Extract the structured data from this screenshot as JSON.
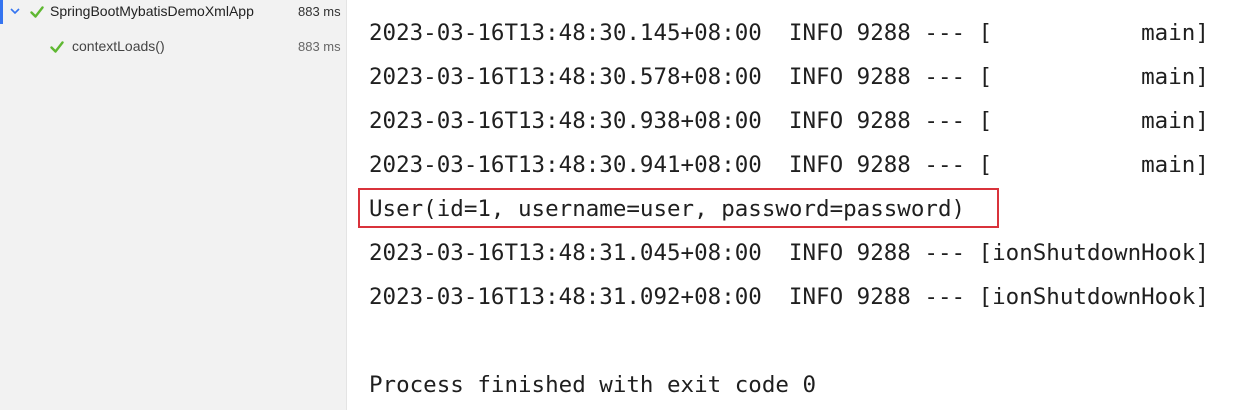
{
  "test_tree": {
    "root": {
      "label": "SpringBootMybatisDemoXmlApp",
      "time": "883 ms",
      "status": "passed"
    },
    "children": [
      {
        "label": "contextLoads()",
        "time": "883 ms",
        "status": "passed"
      }
    ]
  },
  "console": {
    "lines": [
      "2023-03-16T13:48:30.145+08:00  INFO 9288 --- [           main]",
      "2023-03-16T13:48:30.578+08:00  INFO 9288 --- [           main]",
      "2023-03-16T13:48:30.938+08:00  INFO 9288 --- [           main]",
      "2023-03-16T13:48:30.941+08:00  INFO 9288 --- [           main]",
      "User(id=1, username=user, password=password)",
      "2023-03-16T13:48:31.045+08:00  INFO 9288 --- [ionShutdownHook]",
      "2023-03-16T13:48:31.092+08:00  INFO 9288 --- [ionShutdownHook]",
      "",
      "Process finished with exit code 0"
    ]
  },
  "colors": {
    "pass_green": "#5fb832",
    "selection_accent": "#3574f0",
    "highlight_red": "#d9323b"
  }
}
